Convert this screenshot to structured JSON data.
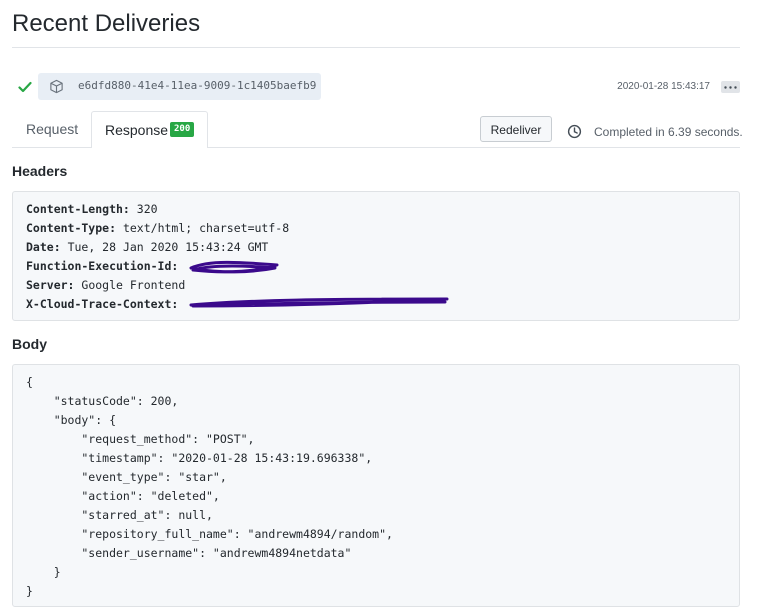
{
  "page": {
    "title": "Recent Deliveries"
  },
  "delivery": {
    "status_icon": "check-icon",
    "guid_icon": "package-icon",
    "guid": "e6dfd880-41e4-11ea-9009-1c1405baefb9",
    "timestamp": "2020-01-28 15:43:17",
    "more_icon": "ellipsis-icon"
  },
  "tabs": {
    "request_label": "Request",
    "response_label": "Response",
    "response_status": "200"
  },
  "actions": {
    "redeliver_label": "Redeliver",
    "clock_icon": "clock-icon",
    "completed_text": "Completed in 6.39 seconds."
  },
  "headers": {
    "heading": "Headers",
    "lines": [
      {
        "name": "Content-Length:",
        "value": "320"
      },
      {
        "name": "Content-Type:",
        "value": "text/html; charset=utf-8"
      },
      {
        "name": "Date:",
        "value": "Tue, 28 Jan 2020 15:43:24 GMT"
      },
      {
        "name": "Function-Execution-Id:",
        "value": ""
      },
      {
        "name": "Server:",
        "value": "Google Frontend"
      },
      {
        "name": "X-Cloud-Trace-Context:",
        "value": ""
      }
    ]
  },
  "body": {
    "heading": "Body",
    "lines": [
      "{",
      "    \"statusCode\": 200,",
      "    \"body\": {",
      "        \"request_method\": \"POST\",",
      "        \"timestamp\": \"2020-01-28 15:43:19.696338\",",
      "        \"event_type\": \"star\",",
      "        \"action\": \"deleted\",",
      "        \"starred_at\": null,",
      "        \"repository_full_name\": \"andrewm4894/random\",",
      "        \"sender_username\": \"andrewm4894netdata\"",
      "    }",
      "}"
    ]
  },
  "colors": {
    "success_green": "#28a745",
    "redaction_purple": "#3b0a8c"
  }
}
